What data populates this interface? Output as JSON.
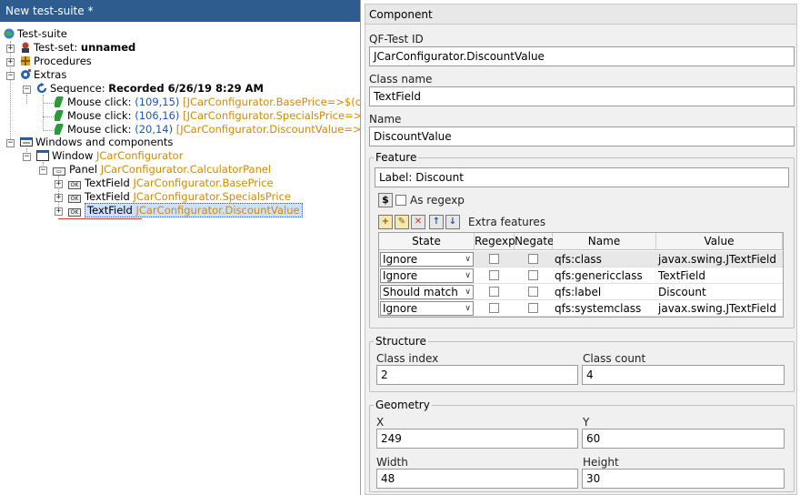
{
  "suite": {
    "title": "New test-suite *",
    "nodes": {
      "root": "Test-suite",
      "testset_prefix": "Test-set: ",
      "testset_name": "unnamed",
      "procedures": "Procedures",
      "extras": "Extras",
      "sequence_prefix": "Sequence: ",
      "sequence_name": "Recorded 6/26/19 8:29 AM",
      "clicks": [
        {
          "prefix": "Mouse click: ",
          "coords": "(109,15)",
          "target": "[JCarConfigurator.BasePrice=>$(client"
        },
        {
          "prefix": "Mouse click: ",
          "coords": "(106,16)",
          "target": "[JCarConfigurator.SpecialsPrice=>$(cli"
        },
        {
          "prefix": "Mouse click: ",
          "coords": "(20,14)",
          "target": "[JCarConfigurator.DiscountValue=>$(cl"
        }
      ],
      "windows": "Windows and components",
      "window_prefix": "Window ",
      "window_name": "JCarConfigurator",
      "panel_prefix": "Panel ",
      "panel_name": "JCarConfigurator.CalculatorPanel",
      "textfields": [
        {
          "prefix": "TextField ",
          "name": "JCarConfigurator.BasePrice"
        },
        {
          "prefix": "TextField ",
          "name": "JCarConfigurator.SpecialsPrice"
        },
        {
          "prefix": "TextField ",
          "name": "JCarConfigurator.DiscountValue"
        }
      ]
    }
  },
  "component": {
    "header": "Component",
    "qftest_id_label": "QF-Test ID",
    "qftest_id_value": "JCarConfigurator.DiscountValue",
    "class_name_label": "Class name",
    "class_name_value": "TextField",
    "name_label": "Name",
    "name_value": "DiscountValue",
    "feature_group": "Feature",
    "feature_value": "Label: Discount",
    "as_regexp_label": "As regexp",
    "extra_features_label": "Extra features",
    "table": {
      "columns": [
        "State",
        "Regexp",
        "Negate",
        "Name",
        "Value"
      ],
      "rows": [
        {
          "state": "Ignore",
          "regexp": false,
          "negate": false,
          "name": "qfs:class",
          "value": "javax.swing.JTextField"
        },
        {
          "state": "Ignore",
          "regexp": false,
          "negate": false,
          "name": "qfs:genericclass",
          "value": "TextField"
        },
        {
          "state": "Should match",
          "regexp": false,
          "negate": false,
          "name": "qfs:label",
          "value": "Discount"
        },
        {
          "state": "Ignore",
          "regexp": false,
          "negate": false,
          "name": "qfs:systemclass",
          "value": "javax.swing.JTextField"
        }
      ]
    },
    "structure_group": "Structure",
    "class_index_label": "Class index",
    "class_index_value": "2",
    "class_count_label": "Class count",
    "class_count_value": "4",
    "geometry_group": "Geometry",
    "x_label": "X",
    "x_value": "249",
    "y_label": "Y",
    "y_value": "60",
    "width_label": "Width",
    "width_value": "48",
    "height_label": "Height",
    "height_value": "30"
  },
  "colors": {
    "title_bar": "#2f5c8f",
    "component_name": "#d08b00",
    "coords": "#1a56c0",
    "leaf_icon": "#2a9a3a"
  }
}
